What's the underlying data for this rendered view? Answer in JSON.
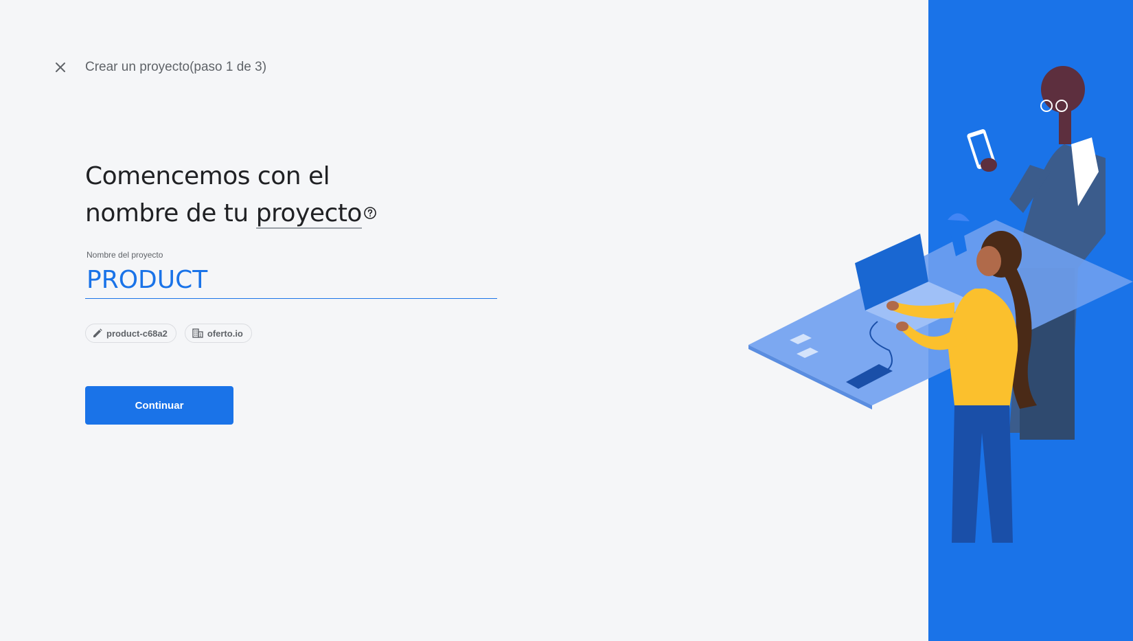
{
  "header": {
    "title": "Crear un proyecto(paso 1 de 3)"
  },
  "headline": {
    "line1": "Comencemos con el",
    "line2_prefix": "nombre de tu ",
    "line2_term": "proyecto"
  },
  "project_name": {
    "label": "Nombre del proyecto",
    "value": "PRODUCT"
  },
  "chips": {
    "project_id": "product-c68a2",
    "organization": "oferto.io"
  },
  "actions": {
    "continue_label": "Continuar"
  },
  "colors": {
    "accent": "#1a73e8",
    "background": "#f5f6f8",
    "panel": "#1a73e8"
  }
}
